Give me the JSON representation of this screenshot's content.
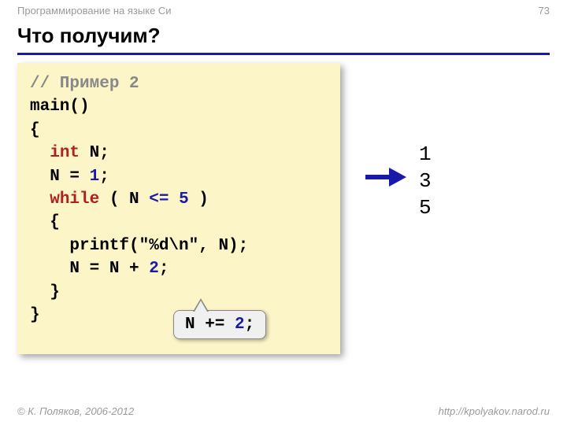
{
  "header": {
    "course": "Программирование на языке Си",
    "pageno": "73"
  },
  "title": "Что получим?",
  "code": {
    "l1_comment": "// Пример 2",
    "l2": "main()",
    "l3": "{",
    "l4_indent": "  ",
    "l4_kw": "int",
    "l4_rest": " N;",
    "l5_a": "  N = ",
    "l5_num": "1",
    "l5_b": ";",
    "l6_indent": "  ",
    "l6_kw": "while",
    "l6_a": " ( N ",
    "l6_op": "<=",
    "l6_sp": " ",
    "l6_num": "5",
    "l6_b": " )",
    "l7": "  {",
    "l8": "    printf(\"%d\\n\", N);",
    "l9_a": "    N = N + ",
    "l9_num": "2",
    "l9_b": ";",
    "l10": "  }",
    "l11": "}"
  },
  "callout": {
    "a": "N += ",
    "num": "2",
    "b": ";"
  },
  "output": {
    "r1": "1",
    "r2": "3",
    "r3": "5"
  },
  "footer": {
    "left": "© К. Поляков, 2006-2012",
    "right": "http://kpolyakov.narod.ru"
  },
  "colors": {
    "keyword": "#b02020",
    "number": "#1a1aa8",
    "comment": "#888888",
    "codeBg": "#fcf5c7",
    "accent": "#1a1aa8"
  }
}
